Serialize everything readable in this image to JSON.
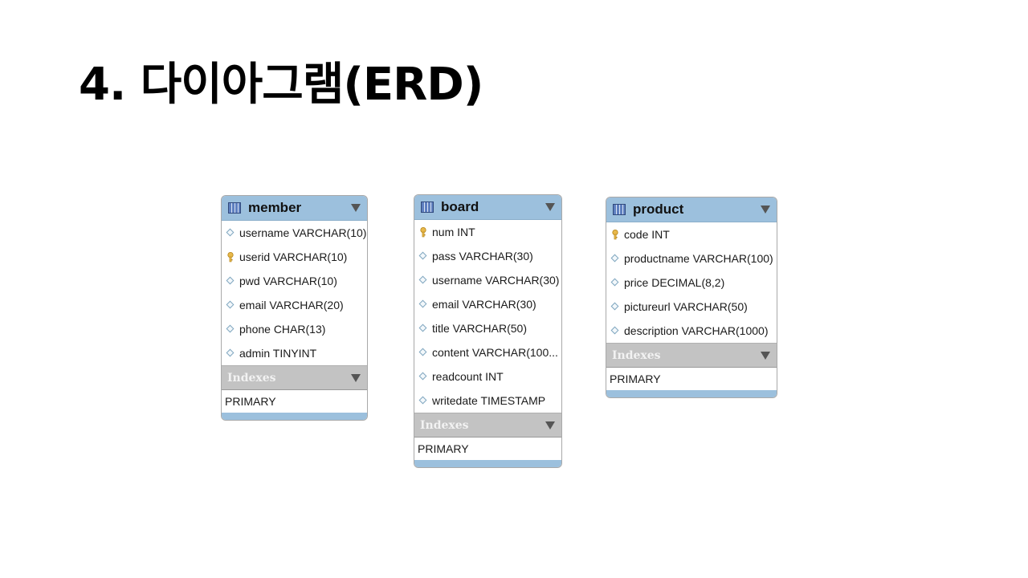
{
  "slide": {
    "title": "4. 다이아그램(ERD)"
  },
  "colors": {
    "header": "#9cc0dd",
    "index_bar": "#c3c3c3",
    "key": "#e8b84a"
  },
  "entities": [
    {
      "name": "member",
      "columns": [
        {
          "text": "username VARCHAR(10)",
          "icon": "diamond-icon"
        },
        {
          "text": "userid VARCHAR(10)",
          "icon": "key-icon"
        },
        {
          "text": "pwd VARCHAR(10)",
          "icon": "diamond-icon"
        },
        {
          "text": "email VARCHAR(20)",
          "icon": "diamond-icon"
        },
        {
          "text": "phone CHAR(13)",
          "icon": "diamond-icon"
        },
        {
          "text": "admin TINYINT",
          "icon": "diamond-icon"
        }
      ],
      "indexes_label": "Indexes",
      "indexes": [
        "PRIMARY"
      ]
    },
    {
      "name": "board",
      "columns": [
        {
          "text": "num INT",
          "icon": "key-icon"
        },
        {
          "text": "pass VARCHAR(30)",
          "icon": "diamond-icon"
        },
        {
          "text": "username VARCHAR(30)",
          "icon": "diamond-icon"
        },
        {
          "text": "email VARCHAR(30)",
          "icon": "diamond-icon"
        },
        {
          "text": "title VARCHAR(50)",
          "icon": "diamond-icon"
        },
        {
          "text": "content VARCHAR(100...",
          "icon": "diamond-icon"
        },
        {
          "text": "readcount INT",
          "icon": "diamond-icon"
        },
        {
          "text": "writedate TIMESTAMP",
          "icon": "diamond-icon"
        }
      ],
      "indexes_label": "Indexes",
      "indexes": [
        "PRIMARY"
      ]
    },
    {
      "name": "product",
      "columns": [
        {
          "text": "code INT",
          "icon": "key-icon"
        },
        {
          "text": "productname VARCHAR(100)",
          "icon": "diamond-icon"
        },
        {
          "text": "price DECIMAL(8,2)",
          "icon": "diamond-icon"
        },
        {
          "text": "pictureurl VARCHAR(50)",
          "icon": "diamond-icon"
        },
        {
          "text": "description VARCHAR(1000)",
          "icon": "diamond-icon"
        }
      ],
      "indexes_label": "Indexes",
      "indexes": [
        "PRIMARY"
      ]
    }
  ]
}
